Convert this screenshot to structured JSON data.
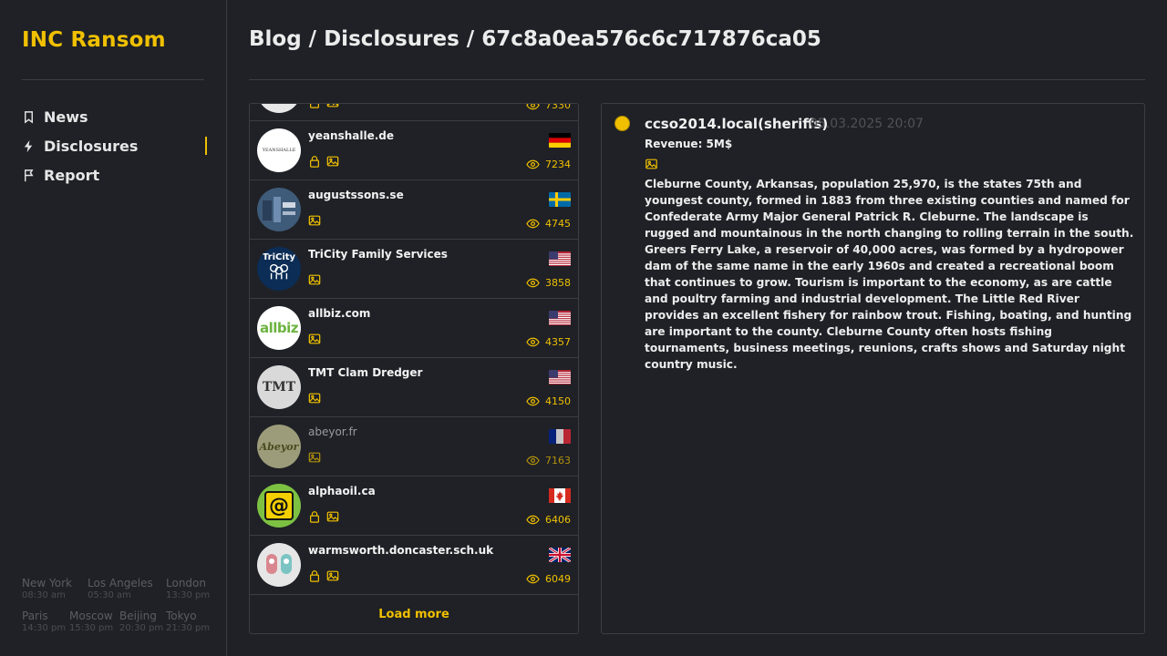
{
  "brand": "INC Ransom",
  "breadcrumb": "Blog / Disclosures / 67c8a0ea576c6c717876ca05",
  "nav": [
    {
      "label": "News",
      "icon": "bookmark-icon"
    },
    {
      "label": "Disclosures",
      "icon": "lightning-icon"
    },
    {
      "label": "Report",
      "icon": "flag-icon"
    }
  ],
  "clocks": [
    {
      "city": "New York",
      "time": "08:30 am"
    },
    {
      "city": "Los Angeles",
      "time": "05:30 am"
    },
    {
      "city": "London",
      "time": "13:30 pm"
    },
    {
      "city": "Paris",
      "time": "14:30 pm"
    },
    {
      "city": "Moscow",
      "time": "15:30 pm"
    },
    {
      "city": "Beijing",
      "time": "20:30 pm"
    },
    {
      "city": "Tokyo",
      "time": "21:30 pm"
    }
  ],
  "list": {
    "top_partial_views": "7330",
    "items": [
      {
        "name": "yeanshalle.de",
        "flag": "de",
        "views": "7234",
        "lock": true,
        "logo_text": "YEANSHALLE"
      },
      {
        "name": "augustssons.se",
        "flag": "se",
        "views": "4745",
        "lock": false,
        "logo_text": ""
      },
      {
        "name": "TriCity Family Services",
        "flag": "us",
        "views": "3858",
        "lock": false,
        "logo_text": "TriCity"
      },
      {
        "name": "allbiz.com",
        "flag": "us",
        "views": "4357",
        "lock": false,
        "logo_text": "allbiz"
      },
      {
        "name": "TMT Clam Dredger",
        "flag": "us",
        "views": "4150",
        "lock": false,
        "logo_text": "TMT"
      },
      {
        "name": "abeyor.fr",
        "flag": "fr",
        "views": "7163",
        "lock": false,
        "logo_text": "Abeyor"
      },
      {
        "name": "alphaoil.ca",
        "flag": "ca",
        "views": "6406",
        "lock": true,
        "logo_text": "@"
      },
      {
        "name": "warmsworth.doncaster.sch.uk",
        "flag": "gb",
        "views": "6049",
        "lock": true,
        "logo_text": ""
      }
    ],
    "load_more": "Load more"
  },
  "detail": {
    "title": "ccso2014.local(sheriffs)",
    "date": "05.03.2025 20:07",
    "revenue": "Revenue: 5M$",
    "description": "Cleburne County, Arkansas, population 25,970, is the states 75th and youngest county, formed in 1883 from three existing counties and named for Confederate Army Major General Patrick R. Cleburne. The landscape is rugged and mountainous in the north changing to rolling terrain in the south. Greers Ferry Lake, a reservoir of 40,000 acres, was formed by a hydropower dam of the same name in the early 1960s and created a recreational boom that continues to grow. Tourism is important to the economy, as are cattle and poultry farming and industrial development. The Little Red River provides an excellent fishery for rainbow trout. Fishing, boating, and hunting are important to the county. Cleburne County often hosts fishing tournaments, business meetings, reunions, crafts shows and Saturday night country music."
  },
  "colors": {
    "accent": "#f0c000",
    "background": "#1f2126",
    "border": "#3b3d42"
  }
}
